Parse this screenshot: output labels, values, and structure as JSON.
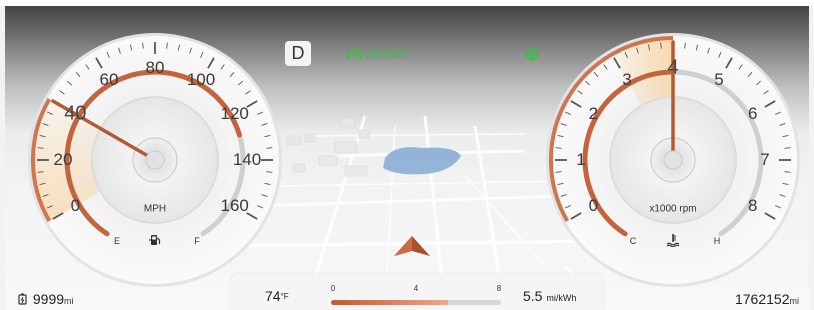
{
  "gear": "D",
  "cruise_label": "CRUISE",
  "icons": {
    "cruise": "cruise-control-icon",
    "steering": "steering-wheel-icon",
    "fuel": "fuel-pump-icon",
    "coolant": "coolant-temperature-icon",
    "battery": "battery-icon",
    "nav": "navigation-arrow-icon"
  },
  "speedometer": {
    "ticks": [
      "0",
      "20",
      "40",
      "60",
      "80",
      "100",
      "120",
      "140",
      "160"
    ],
    "unit": "MPH",
    "value": 40,
    "max": 160,
    "fuel_e": "E",
    "fuel_f": "F",
    "fuel_level": 0.75
  },
  "tachometer": {
    "ticks": [
      "0",
      "1",
      "2",
      "3",
      "4",
      "5",
      "6",
      "7",
      "8"
    ],
    "unit": "x1000 rpm",
    "value": 4,
    "max": 8,
    "temp_c": "C",
    "temp_h": "H",
    "temp_level": 0.5
  },
  "bottom": {
    "temperature": "74",
    "temperature_unit": "°F",
    "efficiency_scale": [
      "0",
      "4",
      "8"
    ],
    "efficiency_value": "5.5",
    "efficiency_unit": "mi/kWh",
    "efficiency_level": 0.69
  },
  "range": {
    "value": "9999",
    "unit": "mi"
  },
  "odometer": {
    "value": "1762152",
    "unit": "mi"
  },
  "colors": {
    "accent": "#c8603a",
    "green": "#1fcf2b"
  }
}
